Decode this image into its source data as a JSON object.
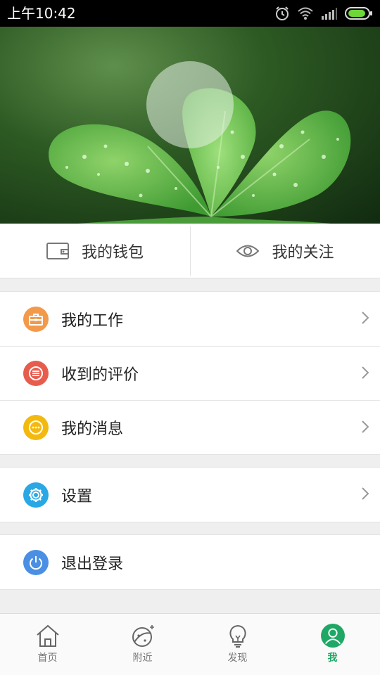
{
  "status_bar": {
    "time": "上午10:42",
    "icons": [
      "alarm-icon",
      "wifi-icon",
      "signal-icon",
      "battery-icon"
    ]
  },
  "profile": {
    "background_image": "four-leaf-clover-with-water-drops",
    "avatar": "avatar-placeholder-circle"
  },
  "quick_actions": [
    {
      "label": "我的钱包",
      "icon": "wallet-icon"
    },
    {
      "label": "我的关注",
      "icon": "eye-icon"
    }
  ],
  "menu": {
    "group1": [
      {
        "label": "我的工作",
        "icon": "briefcase-icon",
        "color": "#f29a4a"
      },
      {
        "label": "收到的评价",
        "icon": "list-icon",
        "color": "#e75c4d"
      },
      {
        "label": "我的消息",
        "icon": "chat-bubble-icon",
        "color": "#f4b90f"
      }
    ],
    "group2": [
      {
        "label": "设置",
        "icon": "gear-icon",
        "color": "#2aa8e6"
      }
    ],
    "group3": [
      {
        "label": "退出登录",
        "icon": "power-icon",
        "color": "#4a8fe3"
      }
    ]
  },
  "tab_bar": [
    {
      "label": "首页",
      "icon": "home-icon",
      "active": false
    },
    {
      "label": "附近",
      "icon": "planet-icon",
      "active": false
    },
    {
      "label": "发现",
      "icon": "lightbulb-icon",
      "active": false
    },
    {
      "label": "我",
      "icon": "profile-icon",
      "active": true
    }
  ],
  "colors": {
    "accent": "#1fa865",
    "background": "#efefef"
  }
}
